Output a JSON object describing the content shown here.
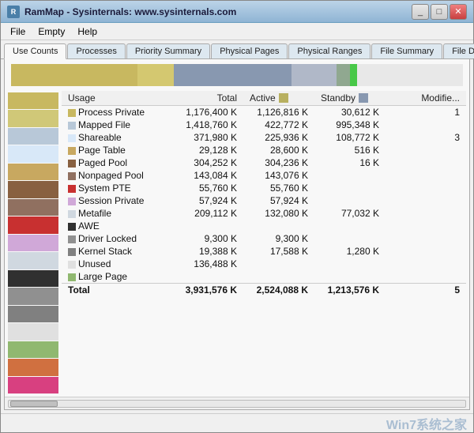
{
  "window": {
    "title": "RamMap - Sysinternals: www.sysinternals.com",
    "icon": "R"
  },
  "titlebar_buttons": {
    "minimize": "_",
    "maximize": "□",
    "close": "✕"
  },
  "menu": {
    "items": [
      "File",
      "Empty",
      "Help"
    ]
  },
  "tabs": [
    {
      "id": "use-counts",
      "label": "Use Counts",
      "active": true
    },
    {
      "id": "processes",
      "label": "Processes",
      "active": false
    },
    {
      "id": "priority-summary",
      "label": "Priority Summary",
      "active": false
    },
    {
      "id": "physical-pages",
      "label": "Physical Pages",
      "active": false
    },
    {
      "id": "physical-ranges",
      "label": "Physical Ranges",
      "active": false
    },
    {
      "id": "file-summary",
      "label": "File Summary",
      "active": false
    },
    {
      "id": "file-details",
      "label": "File Details",
      "active": false
    }
  ],
  "colorbar": [
    {
      "color": "#c8b860",
      "width": "28%"
    },
    {
      "color": "#d4c870",
      "width": "8%"
    },
    {
      "color": "#8898b0",
      "width": "26%"
    },
    {
      "color": "#b0b8c8",
      "width": "10%"
    },
    {
      "color": "#90a890",
      "width": "3%"
    },
    {
      "color": "#48c848",
      "width": "1.5%"
    },
    {
      "color": "#e8e8e8",
      "width": "23.5%"
    }
  ],
  "legend": [
    {
      "color": "#c8b860",
      "height": "28%"
    },
    {
      "color": "#d0c878",
      "height": "5%"
    },
    {
      "color": "#b8c8d8",
      "height": "14%"
    },
    {
      "color": "#d8e8f8",
      "height": "5%"
    },
    {
      "color": "#c8a860",
      "height": "8%"
    },
    {
      "color": "#886040",
      "height": "4%"
    },
    {
      "color": "#907060",
      "height": "4%"
    },
    {
      "color": "#c83030",
      "height": "4%"
    },
    {
      "color": "#d0a8d8",
      "height": "4%"
    },
    {
      "color": "#d0d8e0",
      "height": "6%"
    },
    {
      "color": "#303030",
      "height": "4%"
    },
    {
      "color": "#909090",
      "height": "4%"
    },
    {
      "color": "#808080",
      "height": "4%"
    },
    {
      "color": "#e0e0e0",
      "height": "4%"
    },
    {
      "color": "#90b870",
      "height": "4%"
    },
    {
      "color": "#d07040",
      "height": "4%"
    },
    {
      "color": "#d84080",
      "height": "4%"
    }
  ],
  "table": {
    "columns": [
      "Usage",
      "Total",
      "Active",
      "",
      "Standby",
      "",
      "Modified"
    ],
    "rows": [
      {
        "label": "Process Private",
        "color": "#c8b860",
        "total": "1,176,400 K",
        "active": "1,126,816 K",
        "standby": "30,612 K",
        "modified": "1"
      },
      {
        "label": "Mapped File",
        "color": "#b8c8d8",
        "total": "1,418,760 K",
        "active": "422,772 K",
        "standby": "995,348 K",
        "modified": ""
      },
      {
        "label": "Shareable",
        "color": "#d8e8f8",
        "total": "371,980 K",
        "active": "225,936 K",
        "standby": "108,772 K",
        "modified": "3"
      },
      {
        "label": "Page Table",
        "color": "#c8a860",
        "total": "29,128 K",
        "active": "28,600 K",
        "standby": "516 K",
        "modified": ""
      },
      {
        "label": "Paged Pool",
        "color": "#886040",
        "total": "304,252 K",
        "active": "304,236 K",
        "standby": "16 K",
        "modified": ""
      },
      {
        "label": "Nonpaged Pool",
        "color": "#907060",
        "total": "143,084 K",
        "active": "143,076 K",
        "standby": "",
        "modified": ""
      },
      {
        "label": "System PTE",
        "color": "#c83030",
        "total": "55,760 K",
        "active": "55,760 K",
        "standby": "",
        "modified": ""
      },
      {
        "label": "Session Private",
        "color": "#d0a8d8",
        "total": "57,924 K",
        "active": "57,924 K",
        "standby": "",
        "modified": ""
      },
      {
        "label": "Metafile",
        "color": "#d0d8e0",
        "total": "209,112 K",
        "active": "132,080 K",
        "standby": "77,032 K",
        "modified": ""
      },
      {
        "label": "AWE",
        "color": "#303030",
        "total": "",
        "active": "",
        "standby": "",
        "modified": ""
      },
      {
        "label": "Driver Locked",
        "color": "#909090",
        "total": "9,300 K",
        "active": "9,300 K",
        "standby": "",
        "modified": ""
      },
      {
        "label": "Kernel Stack",
        "color": "#808080",
        "total": "19,388 K",
        "active": "17,588 K",
        "standby": "1,280 K",
        "modified": ""
      },
      {
        "label": "Unused",
        "color": "#e0e0e0",
        "total": "136,488 K",
        "active": "",
        "standby": "",
        "modified": ""
      },
      {
        "label": "Large Page",
        "color": "#90b870",
        "total": "",
        "active": "",
        "standby": "",
        "modified": ""
      }
    ],
    "total_row": {
      "label": "Total",
      "total": "3,931,576 K",
      "active": "2,524,088 K",
      "standby": "1,213,576 K",
      "modified": "5"
    }
  },
  "watermark": "Win7系统之家"
}
